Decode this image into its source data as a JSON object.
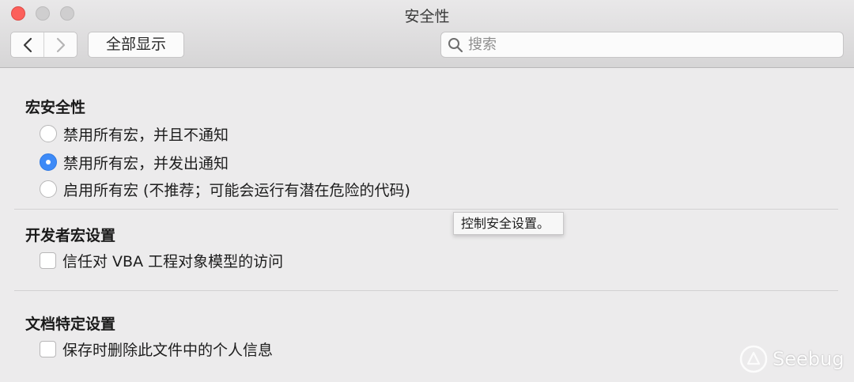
{
  "window": {
    "title": "安全性"
  },
  "toolbar": {
    "show_all_label": "全部显示",
    "search_placeholder": "搜索"
  },
  "sections": [
    {
      "title": "宏安全性",
      "options": [
        {
          "label": "禁用所有宏，并且不通知",
          "type": "radio",
          "checked": false
        },
        {
          "label": "禁用所有宏，并发出通知",
          "type": "radio",
          "checked": true
        },
        {
          "label": "启用所有宏 (不推荐；可能会运行有潜在危险的代码)",
          "type": "radio",
          "checked": false
        }
      ]
    },
    {
      "title": "开发者宏设置",
      "options": [
        {
          "label": "信任对 VBA 工程对象模型的访问",
          "type": "checkbox",
          "checked": false
        }
      ]
    },
    {
      "title": "文档特定设置",
      "options": [
        {
          "label": "保存时删除此文件中的个人信息",
          "type": "checkbox",
          "checked": false
        }
      ]
    }
  ],
  "tooltip": {
    "text": "控制安全设置。"
  },
  "watermark": {
    "text": "Seebug"
  },
  "colors": {
    "accent": "#3d8af7",
    "close_button": "#fc605b"
  }
}
